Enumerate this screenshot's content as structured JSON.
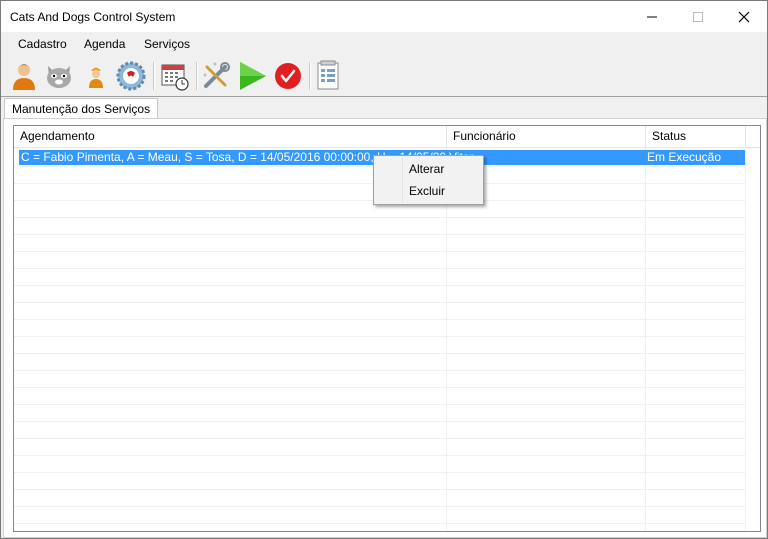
{
  "window": {
    "title": "Cats And Dogs Control System"
  },
  "menu": {
    "items": [
      "Cadastro",
      "Agenda",
      "Serviços"
    ]
  },
  "toolbar": {
    "icons": [
      "person-icon",
      "cat-icon",
      "worker-icon",
      "support-icon",
      "calendar-icon",
      "tools-icon",
      "play-icon",
      "confirm-icon",
      "report-icon"
    ]
  },
  "tabs": [
    {
      "label": "Manutenção dos Serviços"
    }
  ],
  "table": {
    "columns": [
      "Agendamento",
      "Funcionário",
      "Status"
    ],
    "rows": [
      {
        "agendamento": "C = Fabio Pimenta, A = Meau, S = Tosa, D = 14/05/2016 00:00:00, H = 14/05/2016 1",
        "funcionario": "Vitor",
        "status": "Em Execução",
        "selected": true
      }
    ]
  },
  "context_menu": {
    "items": [
      "Alterar",
      "Excluir"
    ]
  },
  "colors": {
    "selection": "#3399ff",
    "grid": "#f0f0f0"
  }
}
